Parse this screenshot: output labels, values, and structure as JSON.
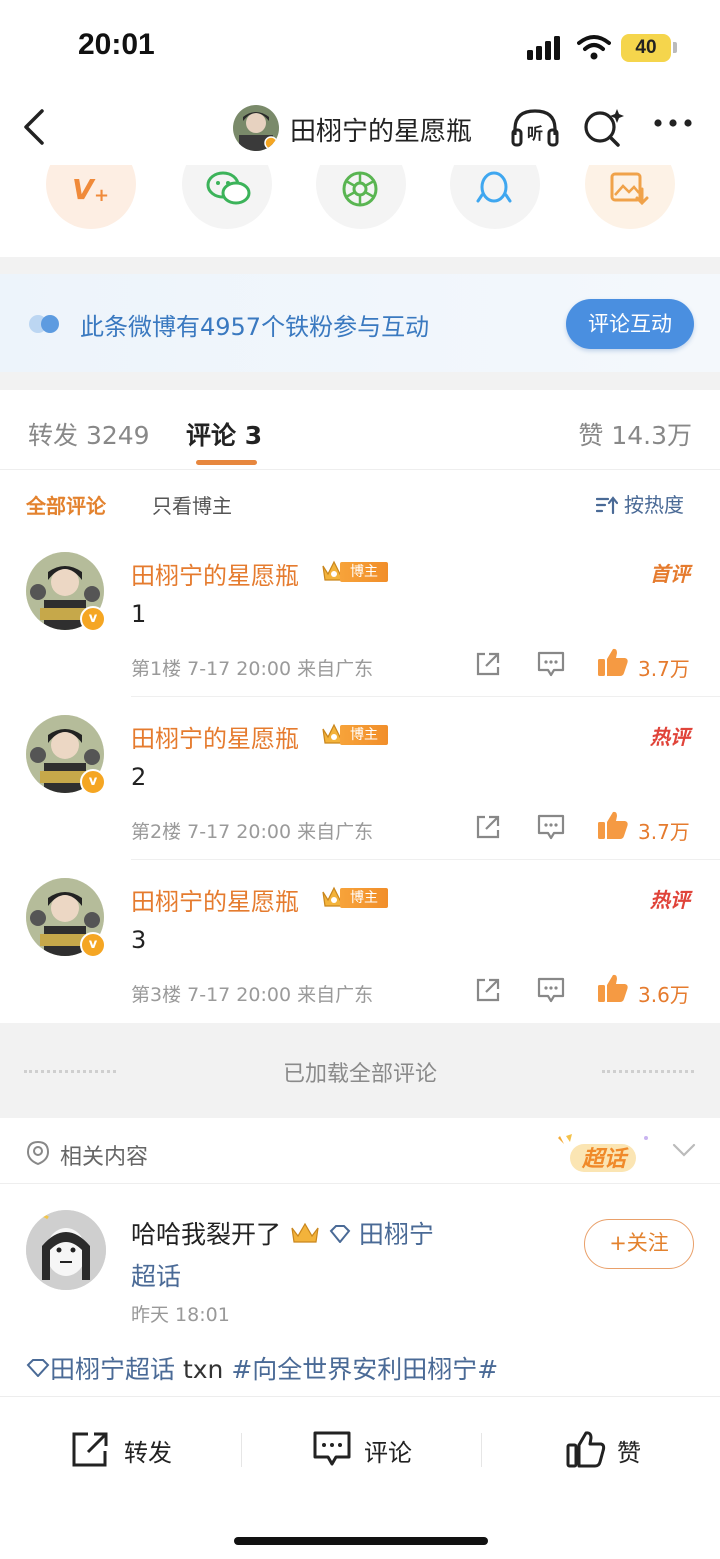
{
  "status_bar": {
    "time": "20:01",
    "battery": "40"
  },
  "nav": {
    "title": "田栩宁的星愿瓶"
  },
  "interaction": {
    "text": "此条微博有4957个铁粉参与互动",
    "button": "评论互动"
  },
  "tabs": {
    "repost": "转发 3249",
    "comment": "评论 3",
    "likes": "赞 14.3万"
  },
  "filters": {
    "all": "全部评论",
    "host_only": "只看博主",
    "sort": "按热度"
  },
  "comments": [
    {
      "name": "田栩宁的星愿瓶",
      "badge": "博主",
      "flag": "首评",
      "text": "1",
      "meta": "第1楼 7-17 20:00 来自广东",
      "likes": "3.7万"
    },
    {
      "name": "田栩宁的星愿瓶",
      "badge": "博主",
      "flag": "热评",
      "text": "2",
      "meta": "第2楼 7-17 20:00 来自广东",
      "likes": "3.7万"
    },
    {
      "name": "田栩宁的星愿瓶",
      "badge": "博主",
      "flag": "热评",
      "text": "3",
      "meta": "第3楼 7-17 20:00 来自广东",
      "likes": "3.6万"
    }
  ],
  "loaded_text": "已加载全部评论",
  "related": {
    "title": "相关内容",
    "supertopic_logo": "超话",
    "post": {
      "text_main": "哈哈我裂开了",
      "topic_name": "田栩宁",
      "topic_suffix": "超话",
      "time": "昨天 18:01",
      "follow": "+关注",
      "tags_topic": "田栩宁超话",
      "tags_plain": " txn ",
      "tags_hashtag": "#向全世界安利田栩宁#"
    }
  },
  "actions": {
    "repost": "转发",
    "comment": "评论",
    "like": "赞"
  },
  "colors": {
    "accent_orange": "#e57b2e",
    "link_blue": "#4a6a96",
    "button_blue": "#4a8fe0"
  }
}
